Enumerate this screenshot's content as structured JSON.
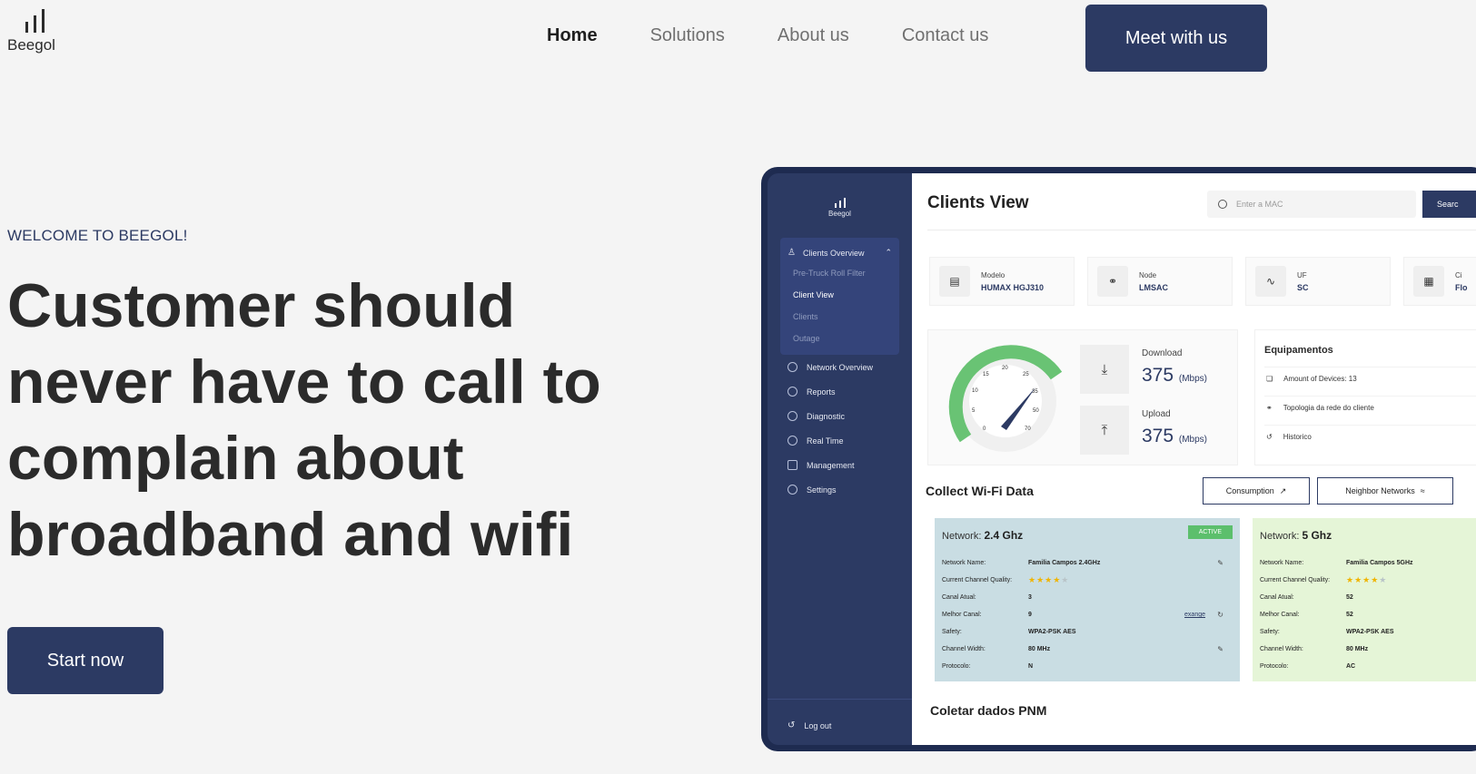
{
  "brand": {
    "name": "Beegol"
  },
  "nav": {
    "items": [
      {
        "label": "Home",
        "active": true
      },
      {
        "label": "Solutions",
        "active": false
      },
      {
        "label": "About us",
        "active": false
      },
      {
        "label": "Contact us",
        "active": false
      }
    ],
    "cta_label": "Meet with us"
  },
  "hero": {
    "eyebrow": "WELCOME TO BEEGOL!",
    "headline": "Customer should never have to call to complain about broadband and wifi",
    "cta_label": "Start now"
  },
  "colors": {
    "primary": "#2c3a63",
    "background": "#f4f4f4",
    "gauge": "#69c374",
    "active_badge": "#5cbf6c"
  },
  "dashboard": {
    "brand": "Beegol",
    "sidebar": {
      "group_label": "Clients Overview",
      "sub_items": [
        "Pre-Truck Roll Filter",
        "Client View",
        "Clients",
        "Outage"
      ],
      "active_sub": "Client View",
      "items": [
        "Network Overview",
        "Reports",
        "Diagnostic",
        "Real Time",
        "Management",
        "Settings"
      ],
      "logout": "Log out"
    },
    "title": "Clients View",
    "search": {
      "placeholder": "Enter a MAC",
      "button": "Searc"
    },
    "cards": [
      {
        "label": "Modelo",
        "value": "HUMAX HGJ310",
        "icon": "router-icon"
      },
      {
        "label": "Node",
        "value": "LMSAC",
        "icon": "share-icon"
      },
      {
        "label": "UF",
        "value": "SC",
        "icon": "pulse-icon"
      },
      {
        "label": "Ci",
        "value": "Flo",
        "icon": "map-icon"
      }
    ],
    "gauge": {
      "ticks": [
        "0",
        "5",
        "10",
        "15",
        "20",
        "25",
        "35",
        "50",
        "70"
      ]
    },
    "speed": {
      "download_label": "Download",
      "download_value": "375",
      "upload_label": "Upload",
      "upload_value": "375",
      "unit": "(Mbps)"
    },
    "equipment": {
      "title": "Equipamentos",
      "rows": [
        "Amount of Devices: 13",
        "Topologia da rede do cliente",
        "Historico"
      ]
    },
    "wifi": {
      "title": "Collect Wi-Fi Data",
      "buttons": [
        "Consumption",
        "Neighbor Networks"
      ],
      "network_label": "Network:",
      "panels": [
        {
          "band": "2.4 Ghz",
          "badge": "ACTIVE",
          "rows": [
            {
              "k": "Network Name:",
              "v": "Familia Campos 2.4GHz"
            },
            {
              "k": "Current Channel Quality:",
              "stars": 4
            },
            {
              "k": "Canal Atual:",
              "v": "3"
            },
            {
              "k": "Melhor Canal:",
              "v": "9"
            },
            {
              "k": "Safety:",
              "v": "WPA2-PSK AES"
            },
            {
              "k": "Channel Width:",
              "v": "80 MHz"
            },
            {
              "k": "Protocolo:",
              "v": "N"
            }
          ],
          "exchange_label": "exange"
        },
        {
          "band": "5 Ghz",
          "rows": [
            {
              "k": "Network Name:",
              "v": "Familia Campos 5GHz"
            },
            {
              "k": "Current Channel Quality:",
              "stars": 4
            },
            {
              "k": "Canal Atual:",
              "v": "52"
            },
            {
              "k": "Melhor Canal:",
              "v": "52"
            },
            {
              "k": "Safety:",
              "v": "WPA2-PSK AES"
            },
            {
              "k": "Channel Width:",
              "v": "80 MHz"
            },
            {
              "k": "Protocolo:",
              "v": "AC"
            }
          ]
        }
      ]
    },
    "pnm_title": "Coletar dados PNM"
  }
}
